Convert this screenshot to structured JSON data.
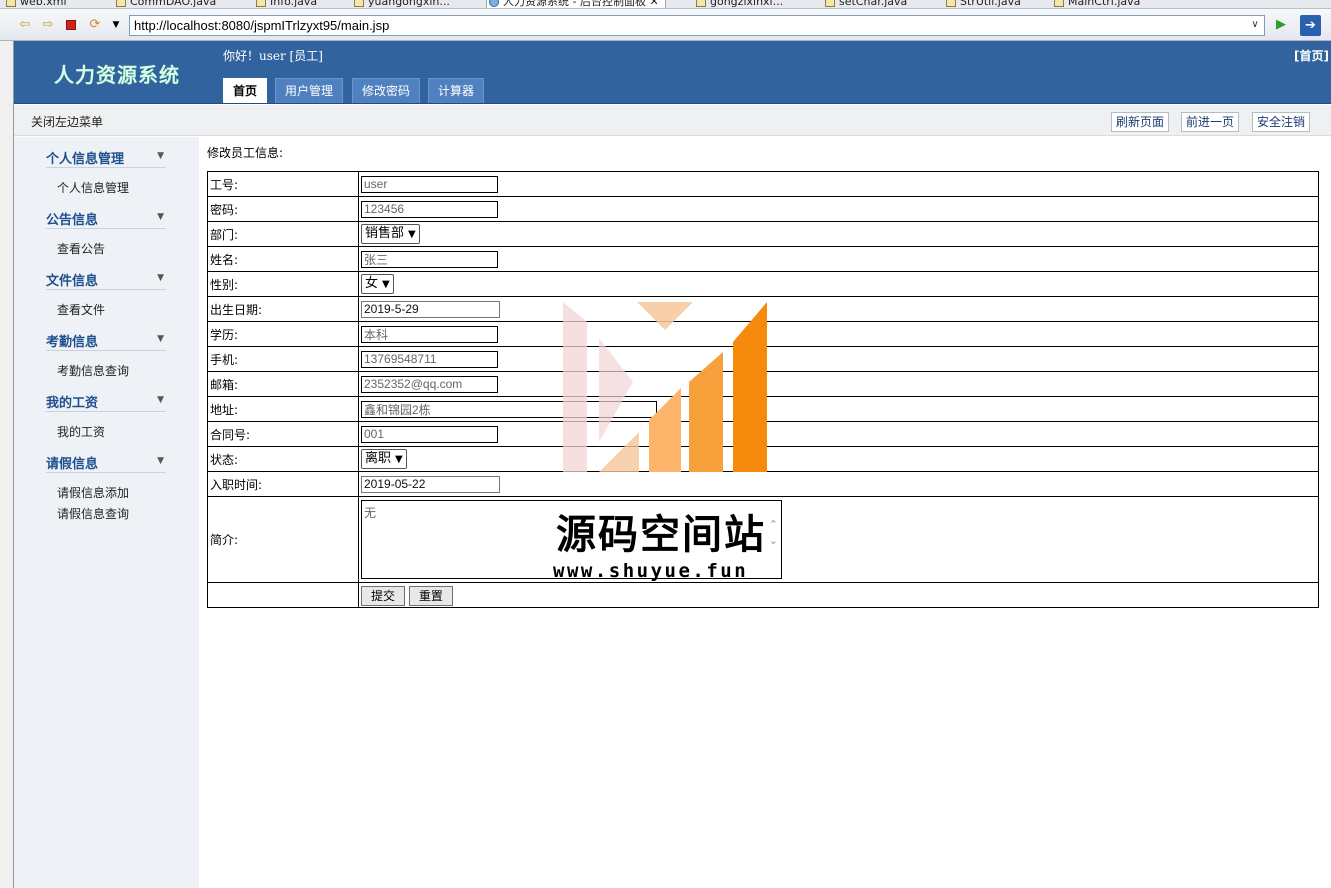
{
  "editor_tabs": [
    {
      "label": "web.xml"
    },
    {
      "label": "CommDAO.java"
    },
    {
      "label": "Info.java"
    },
    {
      "label": "yuangongxin..."
    },
    {
      "label": "人力资源系统 - 后台控制面板",
      "active": true
    },
    {
      "label": "gongzixinxi..."
    },
    {
      "label": "setChar.java"
    },
    {
      "label": "StrUtil.java"
    },
    {
      "label": "MainCtrl.java"
    }
  ],
  "browser": {
    "url": "http://localhost:8080/jspmITrlzyxt95/main.jsp"
  },
  "app": {
    "title": "人力资源系统",
    "greeting": "你好！user [员工]",
    "home_link": "[首页]",
    "tabs": [
      {
        "label": "首页",
        "active": true
      },
      {
        "label": "用户管理"
      },
      {
        "label": "修改密码"
      },
      {
        "label": "计算器"
      }
    ],
    "toggle_menu": "关闭左边菜单",
    "actions": {
      "refresh": "刷新页面",
      "forward": "前进一页",
      "logout": "安全注销"
    }
  },
  "sidebar": {
    "groups": [
      {
        "title": "个人信息管理",
        "items": [
          "个人信息管理"
        ]
      },
      {
        "title": "公告信息",
        "items": [
          "查看公告"
        ]
      },
      {
        "title": "文件信息",
        "items": [
          "查看文件"
        ]
      },
      {
        "title": "考勤信息",
        "items": [
          "考勤信息查询"
        ]
      },
      {
        "title": "我的工资",
        "items": [
          "我的工资"
        ]
      },
      {
        "title": "请假信息",
        "items": [
          "请假信息添加",
          "请假信息查询"
        ]
      }
    ]
  },
  "form": {
    "title": "修改员工信息:",
    "fields": {
      "emp_no": {
        "label": "工号:",
        "value": "user"
      },
      "password": {
        "label": "密码:",
        "value": "123456"
      },
      "dept": {
        "label": "部门:",
        "value": "销售部"
      },
      "name": {
        "label": "姓名:",
        "value": "张三"
      },
      "gender": {
        "label": "性别:",
        "value": "女"
      },
      "birth": {
        "label": "出生日期:",
        "value": "2019-5-29"
      },
      "education": {
        "label": "学历:",
        "value": "本科"
      },
      "phone": {
        "label": "手机:",
        "value": "13769548711"
      },
      "email": {
        "label": "邮箱:",
        "value": "2352352@qq.com"
      },
      "address": {
        "label": "地址:",
        "value": "鑫和锦园2栋"
      },
      "contract": {
        "label": "合同号:",
        "value": "001"
      },
      "status": {
        "label": "状态:",
        "value": "离职"
      },
      "hire_date": {
        "label": "入职时间:",
        "value": "2019-05-22"
      },
      "intro": {
        "label": "简介:",
        "value": "无"
      }
    },
    "submit": "提交",
    "reset": "重置"
  },
  "watermark": {
    "text": "源码空间站",
    "url": "www.shuyue.fun"
  }
}
